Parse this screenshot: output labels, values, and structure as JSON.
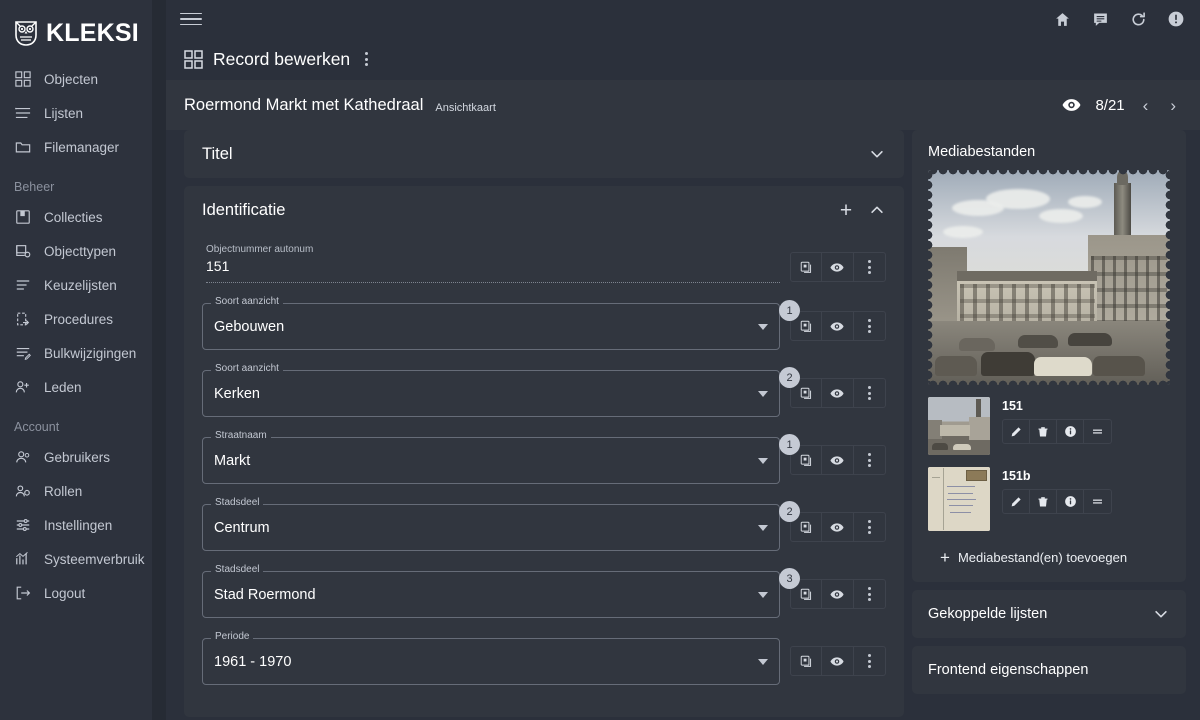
{
  "brand": {
    "name": "KLEKSI",
    "logo_icon": "owl-logo-icon"
  },
  "sidebar": {
    "items": [
      {
        "label": "Objecten",
        "icon": "grid-icon"
      },
      {
        "label": "Lijsten",
        "icon": "list-icon"
      },
      {
        "label": "Filemanager",
        "icon": "folder-icon"
      }
    ],
    "sections": [
      {
        "title": "Beheer",
        "items": [
          {
            "label": "Collecties",
            "icon": "collection-book-icon"
          },
          {
            "label": "Objecttypen",
            "icon": "object-type-icon"
          },
          {
            "label": "Keuzelijsten",
            "icon": "choice-list-icon"
          },
          {
            "label": "Procedures",
            "icon": "procedures-icon"
          },
          {
            "label": "Bulkwijzigingen",
            "icon": "bulk-edit-icon"
          },
          {
            "label": "Leden",
            "icon": "members-add-icon"
          }
        ]
      },
      {
        "title": "Account",
        "items": [
          {
            "label": "Gebruikers",
            "icon": "users-icon"
          },
          {
            "label": "Rollen",
            "icon": "roles-gear-icon"
          },
          {
            "label": "Instellingen",
            "icon": "settings-sliders-icon"
          },
          {
            "label": "Systeemverbruik",
            "icon": "chart-usage-icon"
          },
          {
            "label": "Logout",
            "icon": "logout-icon"
          }
        ]
      }
    ]
  },
  "topbar": {
    "menu_icon": "hamburger-menu-icon",
    "icons": [
      {
        "name": "home-icon"
      },
      {
        "name": "chat-message-icon"
      },
      {
        "name": "refresh-icon"
      },
      {
        "name": "alert-circle-icon"
      }
    ]
  },
  "pagehead": {
    "icon": "grid-four-icon",
    "title": "Record bewerken",
    "menu_icon": "kebab-menu-icon"
  },
  "record": {
    "title": "Roermond Markt met Kathedraal",
    "subtitle": "Ansichtkaart",
    "eye_icon": "eye-icon",
    "counter": "8/21",
    "prev": "‹",
    "next": "›"
  },
  "sections": {
    "titel": {
      "label": "Titel",
      "collapsed": true,
      "chevron_icon": "chevron-down-icon"
    },
    "identificatie": {
      "label": "Identificatie",
      "collapsed": false,
      "add_icon": "plus-icon",
      "chevron_icon": "chevron-up-icon"
    }
  },
  "fields": [
    {
      "type": "plain",
      "label": "Objectnummer autonum",
      "value": "151",
      "badge": null
    },
    {
      "type": "select",
      "label": "Soort aanzicht",
      "value": "Gebouwen",
      "badge": "1"
    },
    {
      "type": "select",
      "label": "Soort aanzicht",
      "value": "Kerken",
      "badge": "2"
    },
    {
      "type": "select",
      "label": "Straatnaam",
      "value": "Markt",
      "badge": "1"
    },
    {
      "type": "select",
      "label": "Stadsdeel",
      "value": "Centrum",
      "badge": "2"
    },
    {
      "type": "select",
      "label": "Stadsdeel",
      "value": "Stad Roermond",
      "badge": "3"
    },
    {
      "type": "select",
      "label": "Periode",
      "value": "1961 - 1970",
      "badge": null
    }
  ],
  "field_tools": [
    {
      "name": "duplicate-icon"
    },
    {
      "name": "eye-icon"
    },
    {
      "name": "kebab-menu-icon"
    }
  ],
  "media": {
    "title": "Mediabestanden",
    "hero_alt": "Roermond Markt met Kathedraal postcard",
    "items": [
      {
        "name": "151"
      },
      {
        "name": "151b"
      }
    ],
    "item_tools": [
      {
        "name": "pencil-edit-icon"
      },
      {
        "name": "trash-delete-icon"
      },
      {
        "name": "info-icon"
      },
      {
        "name": "drag-handle-icon"
      }
    ],
    "add_label": "Mediabestand(en) toevoegen",
    "add_icon": "plus-icon"
  },
  "panels": [
    {
      "label": "Gekoppelde lijsten",
      "chevron_icon": "chevron-down-icon",
      "has_chevron": true
    },
    {
      "label": "Frontend eigenschappen",
      "chevron_icon": "chevron-down-icon",
      "has_chevron": false
    }
  ],
  "colors": {
    "sidebar_bg": "#2d323d",
    "main_bg": "#2b303b",
    "card_bg": "#31363f",
    "text": "#ffffff",
    "muted": "#b9bfc9",
    "badge_bg": "#c5cad4"
  }
}
